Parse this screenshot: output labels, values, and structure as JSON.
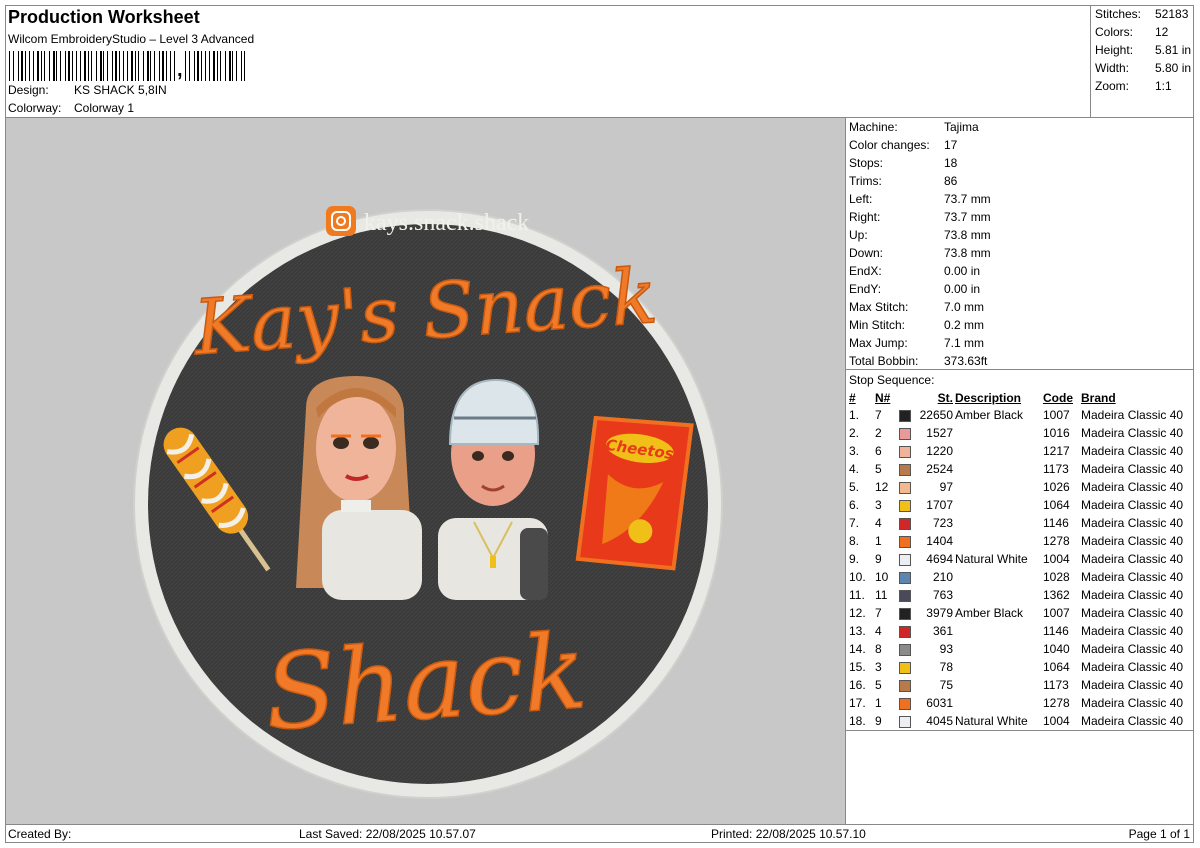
{
  "header": {
    "title": "Production Worksheet",
    "software": "Wilcom EmbroideryStudio – Level 3 Advanced",
    "barcode_suffix": ",",
    "design_label": "Design:",
    "design_value": "KS SHACK 5,8IN",
    "colorway_label": "Colorway:",
    "colorway_value": "Colorway 1"
  },
  "stats": {
    "stitches_label": "Stitches:",
    "stitches": "52183",
    "colors_label": "Colors:",
    "colors": "12",
    "height_label": "Height:",
    "height": "5.81 in",
    "width_label": "Width:",
    "width": "5.80 in",
    "zoom_label": "Zoom:",
    "zoom": "1:1"
  },
  "design": {
    "handle": "kays.snack.shack",
    "line1": "Kay's Snack",
    "line2": "Shack",
    "bag_text": "Cheetos"
  },
  "machine": [
    {
      "k": "Machine:",
      "v": "Tajima"
    },
    {
      "k": "Color changes:",
      "v": "17"
    },
    {
      "k": "Stops:",
      "v": "18"
    },
    {
      "k": "Trims:",
      "v": "86"
    },
    {
      "k": "Left:",
      "v": "73.7 mm"
    },
    {
      "k": "Right:",
      "v": "73.7 mm"
    },
    {
      "k": "Up:",
      "v": "73.8 mm"
    },
    {
      "k": "Down:",
      "v": "73.8 mm"
    },
    {
      "k": "EndX:",
      "v": "0.00 in"
    },
    {
      "k": "EndY:",
      "v": "0.00 in"
    },
    {
      "k": "Max Stitch:",
      "v": "7.0 mm"
    },
    {
      "k": "Min Stitch:",
      "v": "0.2 mm"
    },
    {
      "k": "Max Jump:",
      "v": "7.1 mm"
    },
    {
      "k": "Total Bobbin:",
      "v": "373.63ft"
    }
  ],
  "stop_sequence": {
    "label": "Stop Sequence:",
    "columns": [
      "#",
      "N#",
      "",
      "St.",
      "Description",
      "Code",
      "Brand"
    ],
    "rows": [
      {
        "idx": "1.",
        "n": "7",
        "color": "#222222",
        "st": "22650",
        "desc": "Amber Black",
        "code": "1007",
        "brand": "Madeira Classic 40"
      },
      {
        "idx": "2.",
        "n": "2",
        "color": "#e89a98",
        "st": "1527",
        "desc": "",
        "code": "1016",
        "brand": "Madeira Classic 40"
      },
      {
        "idx": "3.",
        "n": "6",
        "color": "#f0b49a",
        "st": "1220",
        "desc": "",
        "code": "1217",
        "brand": "Madeira Classic 40"
      },
      {
        "idx": "4.",
        "n": "5",
        "color": "#b87a4a",
        "st": "2524",
        "desc": "",
        "code": "1173",
        "brand": "Madeira Classic 40"
      },
      {
        "idx": "5.",
        "n": "12",
        "color": "#f2b890",
        "st": "97",
        "desc": "",
        "code": "1026",
        "brand": "Madeira Classic 40"
      },
      {
        "idx": "6.",
        "n": "3",
        "color": "#f0c018",
        "st": "1707",
        "desc": "",
        "code": "1064",
        "brand": "Madeira Classic 40"
      },
      {
        "idx": "7.",
        "n": "4",
        "color": "#d02828",
        "st": "723",
        "desc": "",
        "code": "1146",
        "brand": "Madeira Classic 40"
      },
      {
        "idx": "8.",
        "n": "1",
        "color": "#f07020",
        "st": "1404",
        "desc": "",
        "code": "1278",
        "brand": "Madeira Classic 40"
      },
      {
        "idx": "9.",
        "n": "9",
        "color": "#eceef2",
        "st": "4694",
        "desc": "Natural White",
        "code": "1004",
        "brand": "Madeira Classic 40"
      },
      {
        "idx": "10.",
        "n": "10",
        "color": "#5a86b0",
        "st": "210",
        "desc": "",
        "code": "1028",
        "brand": "Madeira Classic 40"
      },
      {
        "idx": "11.",
        "n": "11",
        "color": "#4a4a5a",
        "st": "763",
        "desc": "",
        "code": "1362",
        "brand": "Madeira Classic 40"
      },
      {
        "idx": "12.",
        "n": "7",
        "color": "#222222",
        "st": "3979",
        "desc": "Amber Black",
        "code": "1007",
        "brand": "Madeira Classic 40"
      },
      {
        "idx": "13.",
        "n": "4",
        "color": "#d02828",
        "st": "361",
        "desc": "",
        "code": "1146",
        "brand": "Madeira Classic 40"
      },
      {
        "idx": "14.",
        "n": "8",
        "color": "#8a8a8a",
        "st": "93",
        "desc": "",
        "code": "1040",
        "brand": "Madeira Classic 40"
      },
      {
        "idx": "15.",
        "n": "3",
        "color": "#f0c018",
        "st": "78",
        "desc": "",
        "code": "1064",
        "brand": "Madeira Classic 40"
      },
      {
        "idx": "16.",
        "n": "5",
        "color": "#b87a4a",
        "st": "75",
        "desc": "",
        "code": "1173",
        "brand": "Madeira Classic 40"
      },
      {
        "idx": "17.",
        "n": "1",
        "color": "#f07020",
        "st": "6031",
        "desc": "",
        "code": "1278",
        "brand": "Madeira Classic 40"
      },
      {
        "idx": "18.",
        "n": "9",
        "color": "#eceef2",
        "st": "4045",
        "desc": "Natural White",
        "code": "1004",
        "brand": "Madeira Classic 40"
      }
    ]
  },
  "footer": {
    "created_by": "Created By:",
    "last_saved": "Last Saved: 22/08/2025 10.57.07",
    "printed": "Printed: 22/08/2025 10.57.10",
    "page": "Page 1 of 1"
  }
}
